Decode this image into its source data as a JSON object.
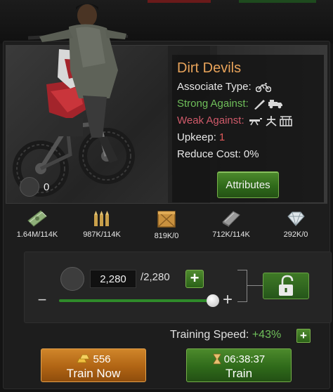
{
  "unit": {
    "name": "Dirt Devils",
    "associate_type_label": "Associate Type:",
    "associate_type_icon": "motorcycle-icon",
    "strong_against_label": "Strong Against:",
    "strong_against_icons": [
      "rifle-icon",
      "truck-icon"
    ],
    "weak_against_label": "Weak Against:",
    "weak_against_icons": [
      "machine-gun-icon",
      "tripod-gun-icon",
      "barricade-icon"
    ],
    "upkeep_label": "Upkeep:",
    "upkeep_value": "1",
    "reduce_cost_label": "Reduce Cost:",
    "reduce_cost_value": "0%",
    "owned_count": "0",
    "attributes_button": "Attributes"
  },
  "resources": [
    {
      "icon": "cash-icon",
      "amount": "1.64M/114K"
    },
    {
      "icon": "ammo-icon",
      "amount": "987K/114K"
    },
    {
      "icon": "crate-icon",
      "amount": "819K/0"
    },
    {
      "icon": "metal-icon",
      "amount": "712K/114K"
    },
    {
      "icon": "diamond-icon",
      "amount": "292K/0"
    }
  ],
  "training": {
    "quantity": "2,280",
    "max": "/2,280",
    "slider_fraction": 1.0,
    "speed_label": "Training Speed:",
    "speed_value": "+43%"
  },
  "buttons": {
    "train_now_cost": "556",
    "train_now_label": "Train Now",
    "train_time": "06:38:37",
    "train_label": "Train"
  },
  "colors": {
    "name": "#e8a35a",
    "strong": "#6fbf5a",
    "weak": "#d05a6a",
    "accent_green": "#3f7a26",
    "accent_orange": "#c07420"
  }
}
